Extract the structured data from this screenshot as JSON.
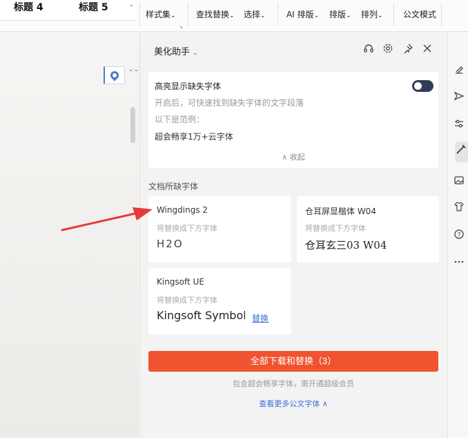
{
  "ribbon": {
    "styles": [
      "标题 4",
      "标题 5"
    ],
    "styles_scroll": "⌄",
    "items": [
      "样式集",
      "查找替换",
      "选择",
      "AI 排版",
      "排版",
      "排列",
      "公文模式"
    ],
    "dropdown_caret": "⌄",
    "launcher": "↘"
  },
  "doc": {
    "locate_icon": "map-pin-icon",
    "side_arrows": "⌄⌄"
  },
  "panel": {
    "title": "美化助手",
    "title_caret": "⌄",
    "header_icons": [
      "headset-icon",
      "gear-icon",
      "pin-icon",
      "close-icon"
    ],
    "highlight": {
      "title": "高亮显示缺失字体",
      "desc": "开启后，可快速找到缺失字体的文字段落",
      "example_label": "以下是范例：",
      "sample": "超会畅享1万+云字体",
      "collapse": "∧ 收起",
      "toggle_on": true
    },
    "missing_section": "文档所缺字体",
    "fonts": [
      {
        "name": "Wingdings 2",
        "hint": "将替换成下方字体",
        "replacement": "H2O",
        "link": ""
      },
      {
        "name": "仓耳屏显楷体 W04",
        "hint": "将替换成下方字体",
        "replacement": "仓耳玄三03 W04",
        "link": ""
      },
      {
        "name": "Kingsoft UE",
        "hint": "将替换成下方字体",
        "replacement": "Kingsoft Symbol",
        "link": "替换"
      }
    ],
    "download_button": "全部下载和替换（3）",
    "note": "包含超会畅享字体，需开通超级会员",
    "more_link": "查看更多公文字体 ∧"
  },
  "rightbar": {
    "icons": [
      "eraser-icon",
      "send-icon",
      "adjust-icon",
      "magic-wand-icon",
      "image-icon",
      "shirt-icon",
      "help-icon",
      "more-icon"
    ],
    "active_index": 3
  },
  "colors": {
    "accent": "#f0532f",
    "link": "#3a6fd8",
    "toggle": "#2f3d55",
    "arrow": "#e5393a"
  }
}
